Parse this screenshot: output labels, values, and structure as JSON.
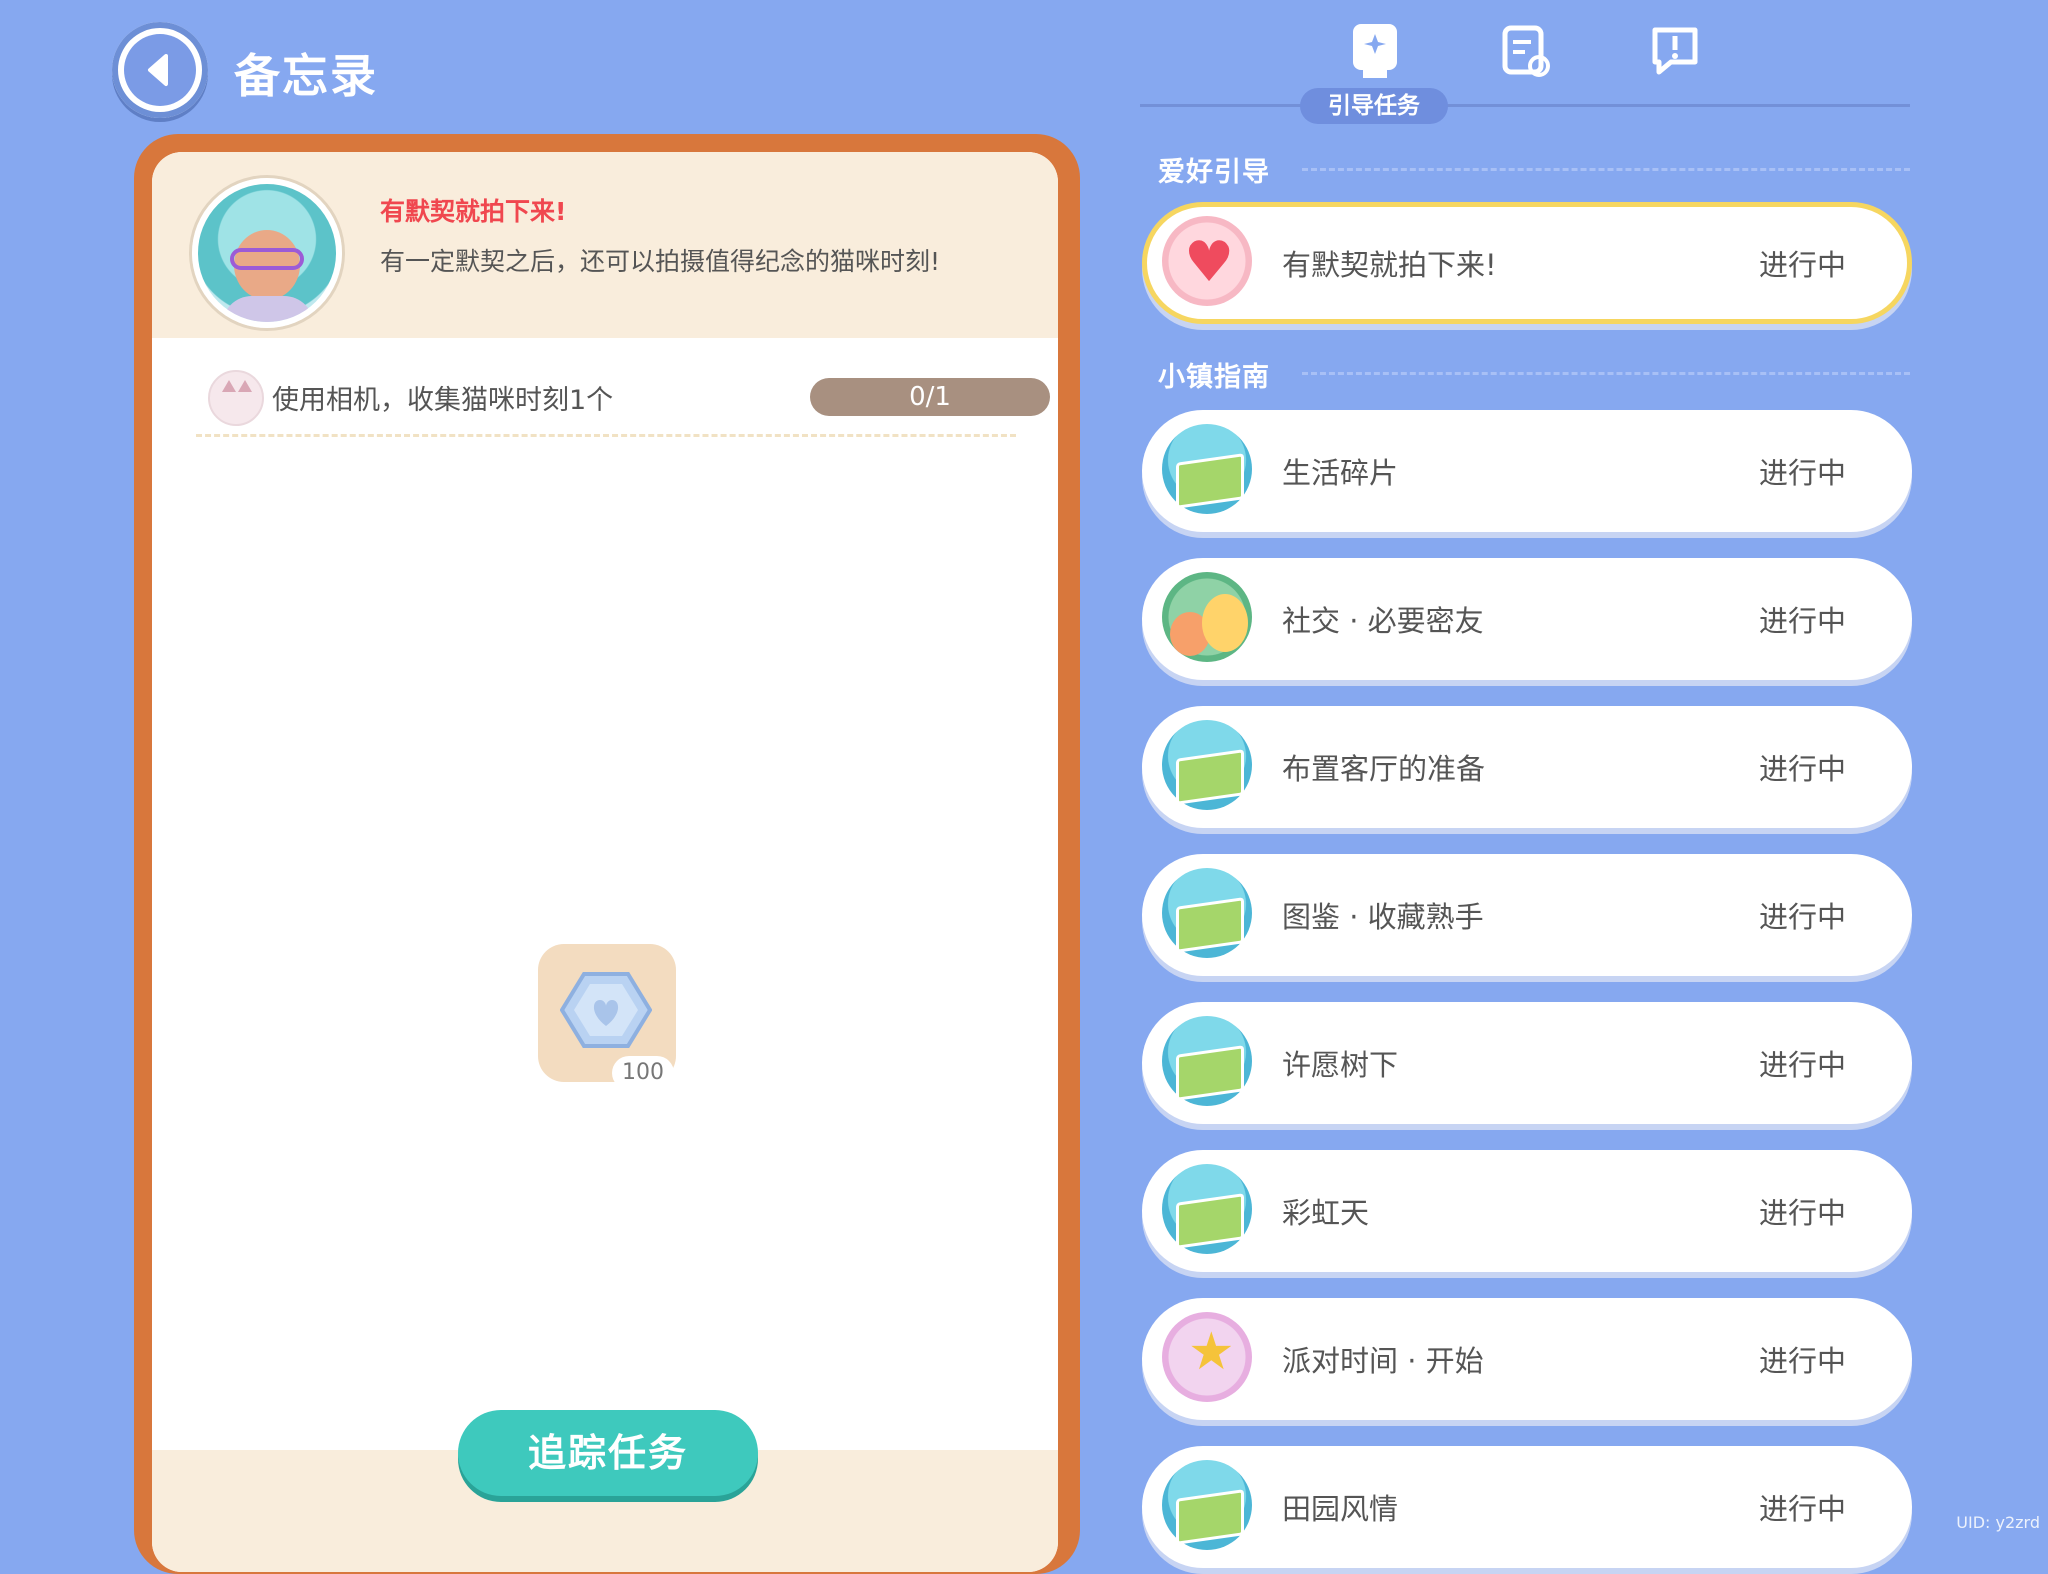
{
  "header": {
    "title": "备忘录"
  },
  "detail": {
    "task_title": "有默契就拍下来!",
    "task_desc": "有一定默契之后，还可以拍摄值得纪念的猫咪时刻!",
    "objective": {
      "text": "使用相机，收集猫咪时刻1个",
      "progress": "0/1"
    },
    "reward": {
      "count": "100",
      "icon": "heart-gem-icon"
    },
    "track_button": "追踪任务"
  },
  "tabs": {
    "active_label": "引导任务",
    "items": [
      {
        "icon": "guide-book-icon",
        "active": true
      },
      {
        "icon": "clipboard-refresh-icon",
        "active": false
      },
      {
        "icon": "exclamation-chat-icon",
        "active": false
      }
    ]
  },
  "sections": [
    {
      "title": "爱好引导"
    },
    {
      "title": "小镇指南"
    }
  ],
  "quests": [
    {
      "name": "有默契就拍下来!",
      "status": "进行中",
      "icon": "heart-icon",
      "selected": true
    },
    {
      "name": "生活碎片",
      "status": "进行中",
      "icon": "map-icon"
    },
    {
      "name": "社交 · 必要密友",
      "status": "进行中",
      "icon": "friends-icon"
    },
    {
      "name": "布置客厅的准备",
      "status": "进行中",
      "icon": "map-icon"
    },
    {
      "name": "图鉴 · 收藏熟手",
      "status": "进行中",
      "icon": "map-icon"
    },
    {
      "name": "许愿树下",
      "status": "进行中",
      "icon": "map-icon"
    },
    {
      "name": "彩虹天",
      "status": "进行中",
      "icon": "map-icon"
    },
    {
      "name": "派对时间 · 开始",
      "status": "进行中",
      "icon": "party-icon"
    },
    {
      "name": "田园风情",
      "status": "进行中",
      "icon": "map-icon"
    }
  ],
  "footer": {
    "corner_text": "UID: y2zrd"
  },
  "colors": {
    "background": "#86a8f0",
    "card_border": "#d8773c",
    "accent_red": "#f0474f",
    "track_button": "#3ec9bd",
    "selected_border": "#f6d660"
  }
}
